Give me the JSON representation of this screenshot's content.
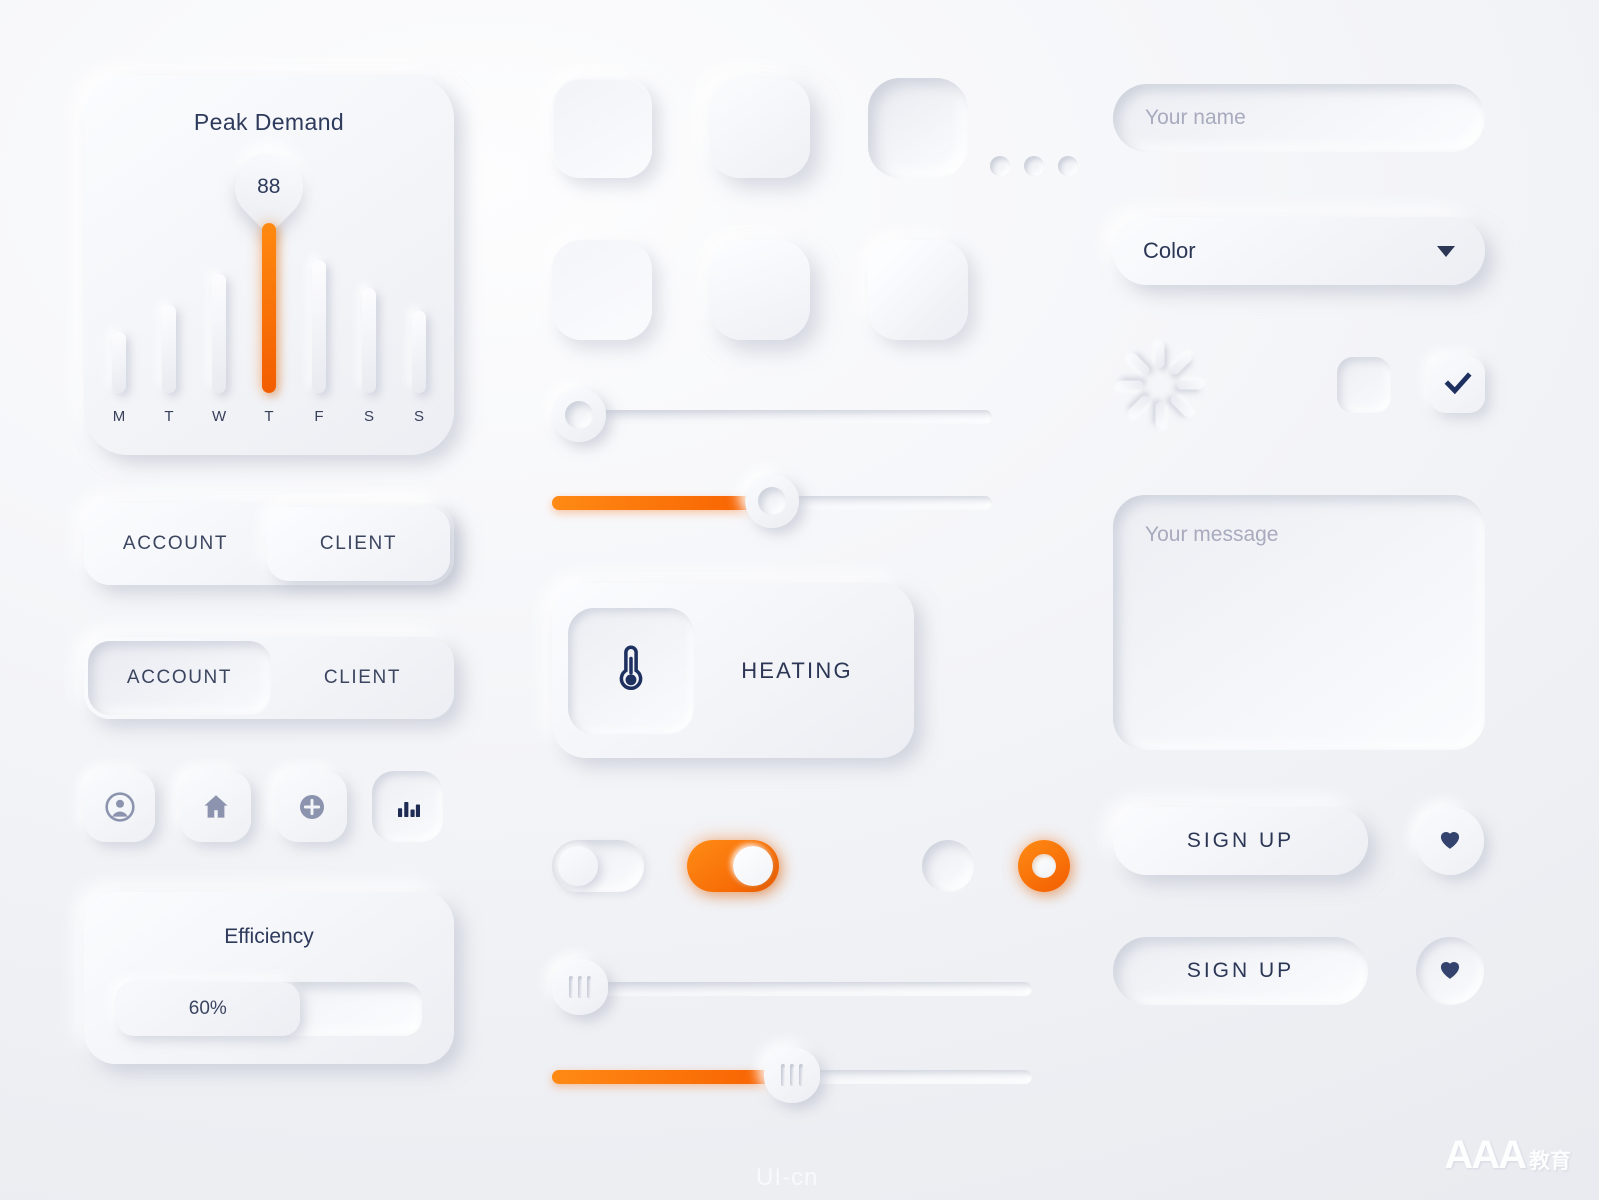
{
  "theme": {
    "accent": "#F96A00",
    "accent_light": "#FF8C15",
    "text_dark": "#2C3655",
    "text_muted": "#A7ABBD",
    "surface": "#F2F4F8"
  },
  "left_column": {
    "peak_card": {
      "title": "Peak Demand",
      "bubble_value": "88"
    },
    "chart_data": {
      "type": "bar",
      "title": "Peak Demand",
      "categories": [
        "M",
        "T",
        "W",
        "T",
        "F",
        "S",
        "S"
      ],
      "values": [
        36,
        52,
        70,
        100,
        78,
        62,
        48
      ],
      "highlight_index": 3,
      "highlight_value_label": "88",
      "xlabel": "",
      "ylabel": "",
      "ylim": [
        0,
        100
      ],
      "grid": false,
      "legend": false,
      "series": [
        {
          "name": "Demand",
          "values": [
            36,
            52,
            70,
            100,
            78,
            62,
            48
          ]
        }
      ]
    },
    "tabs_raised": {
      "items": [
        {
          "label": "ACCOUNT",
          "state": "inactive"
        },
        {
          "label": "CLIENT",
          "state": "active-raised"
        }
      ]
    },
    "tabs_inset": {
      "items": [
        {
          "label": "ACCOUNT",
          "state": "active-inset"
        },
        {
          "label": "CLIENT",
          "state": "inactive"
        }
      ]
    },
    "icon_buttons": [
      {
        "name": "user-icon",
        "style": "raised"
      },
      {
        "name": "home-icon",
        "style": "raised"
      },
      {
        "name": "plus-circle-icon",
        "style": "raised"
      },
      {
        "name": "bar-chart-icon",
        "style": "inset-active"
      }
    ],
    "efficiency_card": {
      "title": "Efficiency",
      "value_label": "60%",
      "percent": 60
    }
  },
  "middle_column": {
    "square_buttons": [
      {
        "name": "square-button-1",
        "style": "flat-raised"
      },
      {
        "name": "square-button-2",
        "style": "soft-raised"
      },
      {
        "name": "square-button-3",
        "style": "inset"
      },
      {
        "name": "square-button-4",
        "style": "flat-raised"
      },
      {
        "name": "square-button-5",
        "style": "soft-raised"
      },
      {
        "name": "square-button-6",
        "style": "diagonal-raised"
      }
    ],
    "sliders_top": [
      {
        "name": "slider-ring-empty",
        "value": 0,
        "fill": false,
        "handle": "ring"
      },
      {
        "name": "slider-ring-half",
        "value": 50,
        "fill": true,
        "handle": "ring"
      }
    ],
    "heating_card": {
      "label": "HEATING",
      "icon": "thermometer-icon"
    },
    "dots_count": 3,
    "switches": [
      {
        "name": "toggle-off",
        "state": "off"
      },
      {
        "name": "toggle-on",
        "state": "on"
      },
      {
        "name": "radio-off",
        "state": "off"
      },
      {
        "name": "radio-on",
        "state": "on"
      }
    ],
    "sliders_bottom": [
      {
        "name": "slider-grip-empty",
        "value": 0,
        "fill": false,
        "handle": "grip"
      },
      {
        "name": "slider-grip-half",
        "value": 50,
        "fill": true,
        "handle": "grip"
      }
    ]
  },
  "right_column": {
    "name_input": {
      "placeholder": "Your name",
      "value": ""
    },
    "color_select": {
      "selected": "Color",
      "caret": "chevron-down-icon"
    },
    "spinner": {
      "name": "loading-spinner-icon",
      "spokes": 8
    },
    "checkbox_unchecked": {
      "name": "checkbox-unchecked",
      "checked": false
    },
    "checkbox_checked": {
      "name": "checkbox-checked",
      "checked": true,
      "glyph": "check-icon"
    },
    "message_textarea": {
      "placeholder": "Your message",
      "value": ""
    },
    "signup_primary": {
      "label": "SIGN UP",
      "style": "raised"
    },
    "signup_secondary": {
      "label": "SIGN UP",
      "style": "inset"
    },
    "heart_primary": {
      "name": "heart-icon",
      "style": "raised"
    },
    "heart_secondary": {
      "name": "heart-icon",
      "style": "inset"
    }
  },
  "watermarks": {
    "brand": "AAA",
    "brand_suffix": "教育",
    "site": "UI-cn"
  }
}
